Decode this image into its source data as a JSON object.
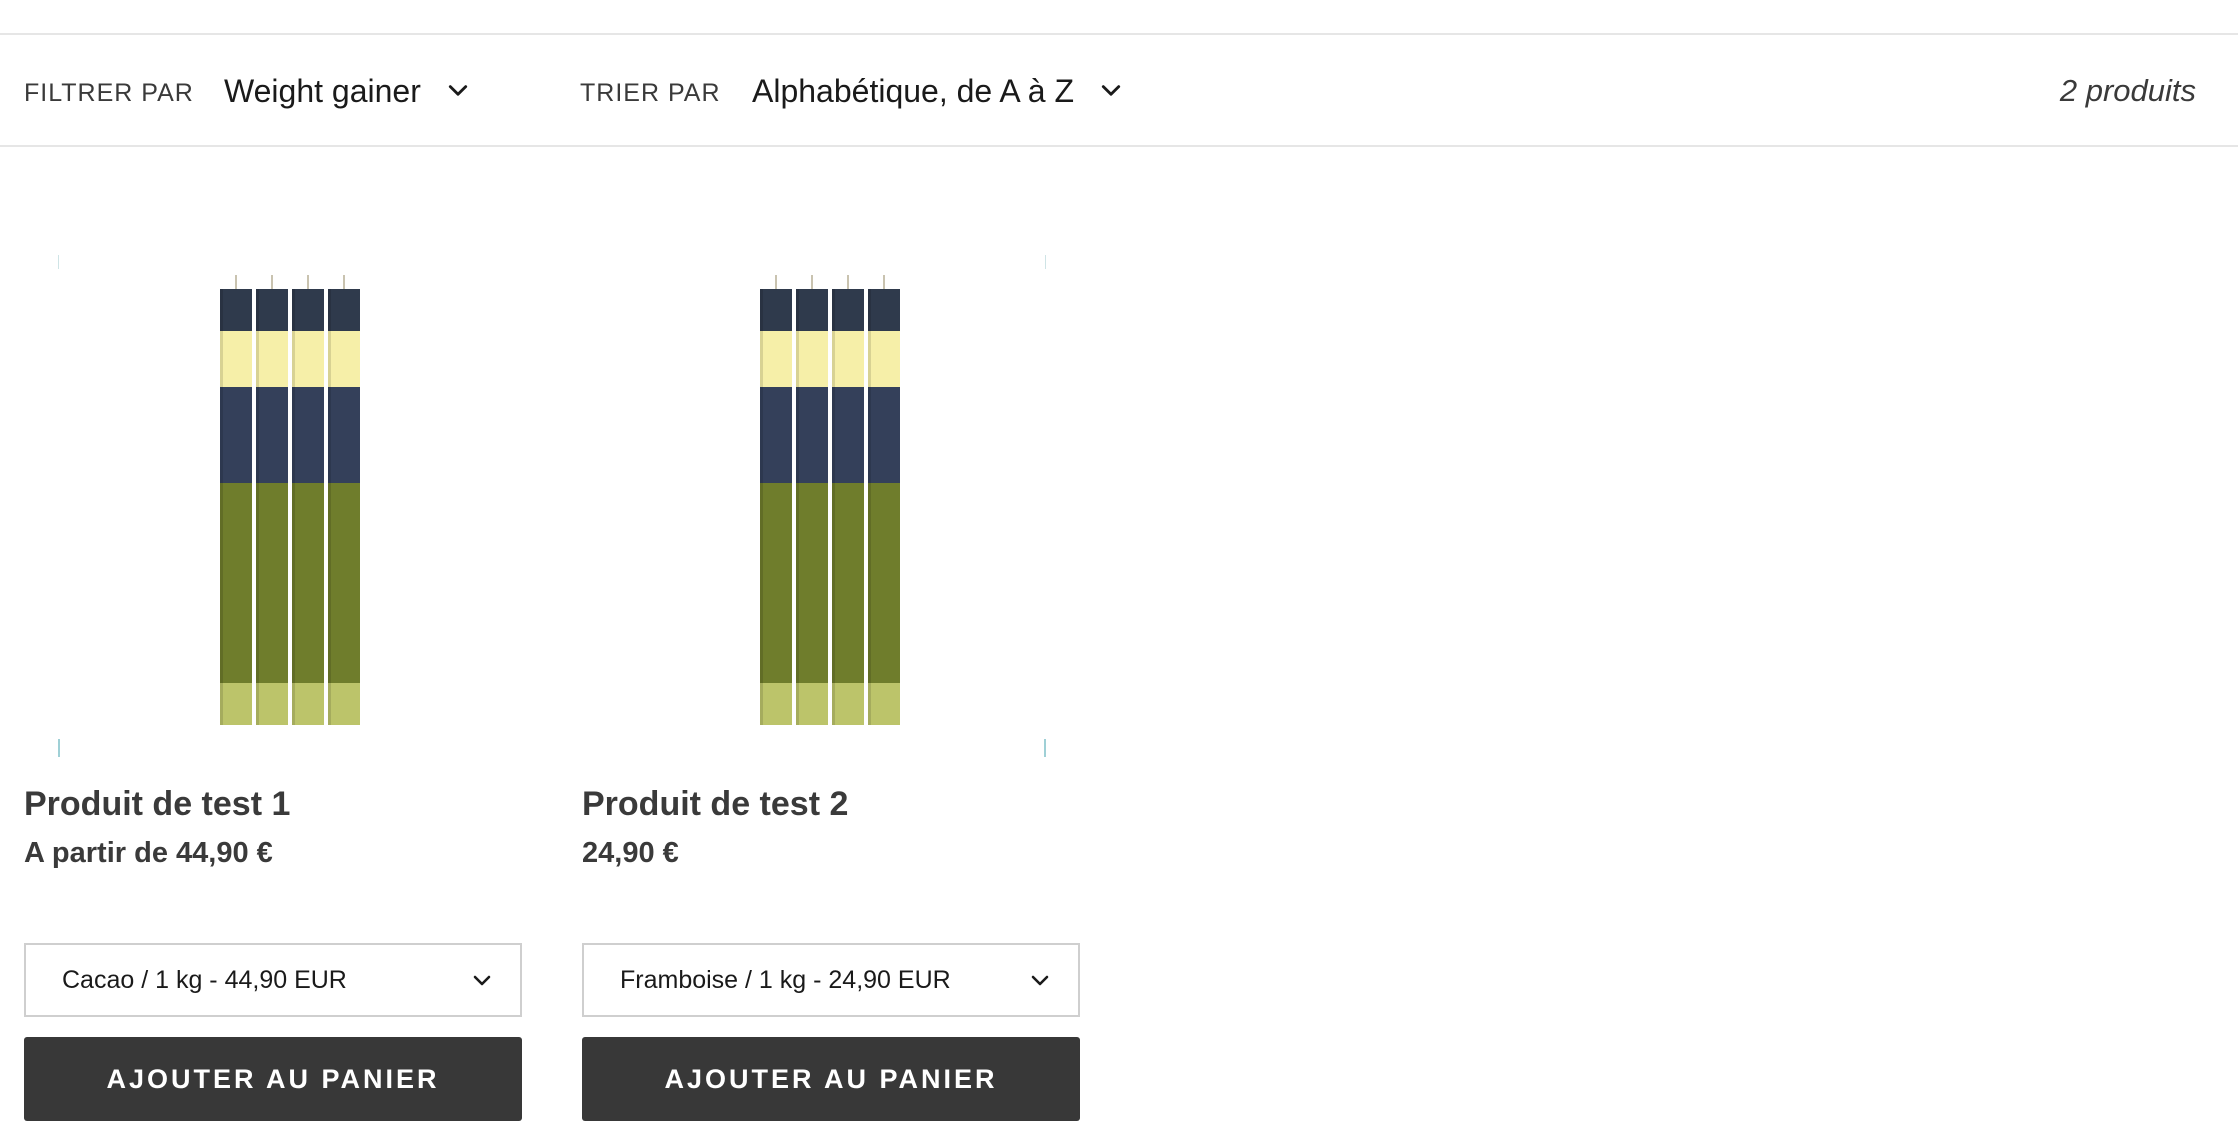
{
  "filter": {
    "label": "FILTRER PAR",
    "value": "Weight gainer"
  },
  "sort": {
    "label": "TRIER PAR",
    "value": "Alphabétique, de A à Z"
  },
  "product_count": "2 produits",
  "products": [
    {
      "title": "Produit de test 1",
      "price": "A partir de 44,90 €",
      "variant": "Cacao / 1 kg - 44,90 EUR",
      "add_to_cart": "AJOUTER AU PANIER"
    },
    {
      "title": "Produit de test 2",
      "price": "24,90 €",
      "variant": "Framboise / 1 kg - 24,90 EUR",
      "add_to_cart": "AJOUTER AU PANIER"
    }
  ],
  "colors": {
    "button_bg": "#383838",
    "text": "#3a3a3a",
    "candle_navy": "#2f3a4c",
    "candle_cream": "#f6efa8",
    "candle_olive": "#6f7d2c",
    "candle_lime": "#bcc46a"
  }
}
